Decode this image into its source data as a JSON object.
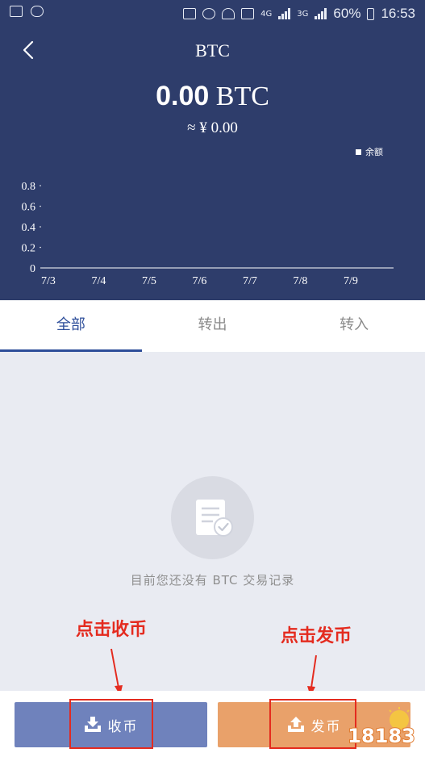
{
  "status_bar": {
    "battery": "60%",
    "time": "16:53",
    "net1": "4G",
    "net2": "3G"
  },
  "header": {
    "title": "BTC",
    "balance_amount": "0.00",
    "balance_unit": "BTC",
    "fiat_value": "≈ ¥ 0.00"
  },
  "chart_data": {
    "type": "line",
    "categories": [
      "7/3",
      "7/4",
      "7/5",
      "7/6",
      "7/7",
      "7/8",
      "7/9"
    ],
    "series": [
      {
        "name": "余额",
        "values": [
          0,
          0,
          0,
          0,
          0,
          0,
          0
        ]
      }
    ],
    "y_ticks": [
      "0.8",
      "0.6",
      "0.4",
      "0.2",
      "0"
    ],
    "ylim": [
      0,
      0.8
    ],
    "legend": "top-right",
    "grid": false
  },
  "tabs": [
    {
      "label": "全部",
      "active": true
    },
    {
      "label": "转出",
      "active": false
    },
    {
      "label": "转入",
      "active": false
    }
  ],
  "empty_state": {
    "icon": "document-check-icon",
    "message": "目前您还没有 BTC 交易记录"
  },
  "annotations": {
    "left": "点击收币",
    "right": "点击发币"
  },
  "buttons": {
    "receive": "收币",
    "send": "发币"
  },
  "watermark": "18183",
  "colors": {
    "header_bg": "#2e3d6b",
    "tab_active": "#2e4e9a",
    "receive_btn": "#6f82bc",
    "send_btn": "#e9a16a",
    "annotation_red": "#e42b1f"
  }
}
